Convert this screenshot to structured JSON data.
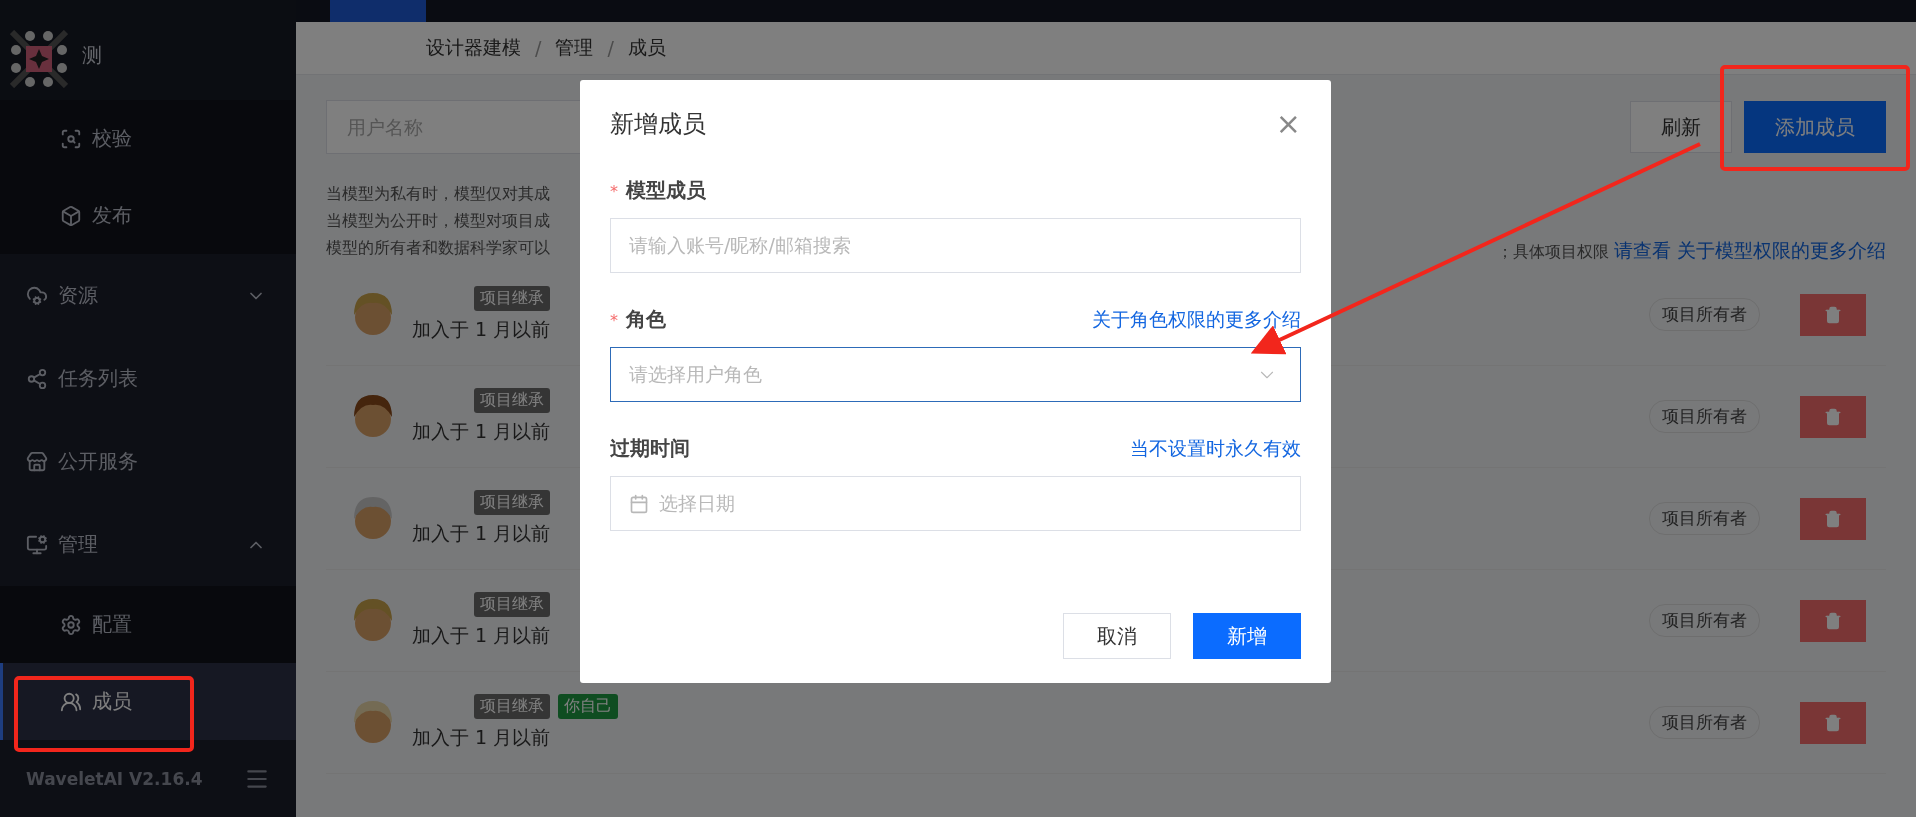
{
  "sidebar": {
    "logo_text": "测",
    "items": [
      {
        "children": [
          {
            "label": "校验",
            "selected": false
          },
          {
            "label": "发布",
            "selected": false
          }
        ]
      },
      {
        "label": "资源",
        "expanded": false,
        "selected": false
      },
      {
        "label": "任务列表",
        "selected": false
      },
      {
        "label": "公开服务",
        "selected": false
      },
      {
        "label": "管理",
        "expanded": true,
        "selected": false,
        "children": [
          {
            "label": "配置",
            "selected": false
          },
          {
            "label": "成员",
            "selected": true
          }
        ]
      }
    ],
    "version": "WaveletAI V2.16.4"
  },
  "breadcrumb": {
    "items": [
      "设计器建模",
      "管理",
      "成员"
    ],
    "separator": "/"
  },
  "toolbar": {
    "search": {
      "placeholder": "用户名称"
    },
    "buttons": [
      {
        "label": "刷新",
        "kind": "default"
      },
      {
        "label": "添加成员",
        "kind": "primary"
      }
    ]
  },
  "description": {
    "lines": [
      "当模型为私有时，模型仅对其成",
      "当模型为公开时，模型对项目成",
      "模型的所有者和数据科学家可以"
    ],
    "tail": "；具体项目权限",
    "link": "请查看 关于模型权限的更多介绍"
  },
  "members": [
    {
      "tags": [
        {
          "label": "项目继承",
          "kind": "inherit"
        }
      ],
      "joined": "加入于 1 月以前",
      "role": "项目所有者"
    },
    {
      "tags": [
        {
          "label": "项目继承",
          "kind": "inherit"
        }
      ],
      "joined": "加入于 1 月以前",
      "role": "项目所有者"
    },
    {
      "tags": [
        {
          "label": "项目继承",
          "kind": "inherit"
        }
      ],
      "joined": "加入于 1 月以前",
      "role": "项目所有者"
    },
    {
      "tags": [
        {
          "label": "项目继承",
          "kind": "inherit"
        }
      ],
      "joined": "加入于 1 月以前",
      "role": "项目所有者"
    },
    {
      "tags": [
        {
          "label": "项目继承",
          "kind": "inherit"
        },
        {
          "label": "你自己",
          "kind": "self"
        }
      ],
      "joined": "加入于 1 月以前",
      "role": "项目所有者"
    }
  ],
  "dialog": {
    "title": "新增成员",
    "close": "×",
    "fields": [
      {
        "label": "模型成员",
        "required_mark": "*",
        "kind": "text",
        "placeholder": "请输入账号/昵称/邮箱搜索",
        "focused": false
      },
      {
        "label": "角色",
        "required_mark": "*",
        "kind": "select",
        "placeholder": "请选择用户角色",
        "link": "关于角色权限的更多介绍",
        "focused": true
      },
      {
        "label": "过期时间",
        "kind": "date",
        "placeholder": "选择日期",
        "link": "当不设置时永久有效",
        "focused": false
      }
    ],
    "buttons": [
      {
        "label": "取消",
        "kind": "default"
      },
      {
        "label": "新增",
        "kind": "primary"
      }
    ]
  }
}
